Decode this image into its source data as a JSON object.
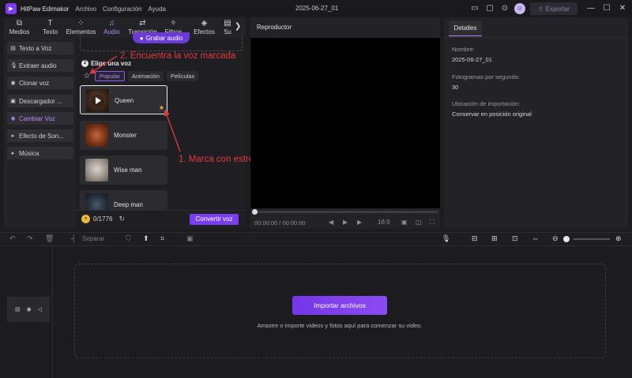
{
  "app": {
    "name": "HitPaw Edimakor",
    "menu": [
      "Archivo",
      "Configuración",
      "Ayuda"
    ],
    "project_name": "2025-06-27_01",
    "export_label": "Exportar",
    "accent_color": "#8a4ff0"
  },
  "tabs": [
    {
      "label": "Medios",
      "icon": "media-icon"
    },
    {
      "label": "Texto",
      "icon": "text-icon"
    },
    {
      "label": "Elementos",
      "icon": "elements-icon"
    },
    {
      "label": "Audio",
      "icon": "music-note-icon",
      "active": true
    },
    {
      "label": "Transición",
      "icon": "transition-icon"
    },
    {
      "label": "Filtros",
      "icon": "filters-icon"
    },
    {
      "label": "Efectos",
      "icon": "effects-icon"
    },
    {
      "label": "Su",
      "icon": "subtitles-icon"
    }
  ],
  "sidebar": {
    "items": [
      {
        "label": "Texto a Voz",
        "icon": "document-icon"
      },
      {
        "label": "Extraer audio",
        "icon": "microphone-icon"
      },
      {
        "label": "Clonar voz",
        "icon": "clone-icon"
      },
      {
        "label": "Descargador ...",
        "icon": "download-icon"
      },
      {
        "label": "Cambiar Voz",
        "icon": "voice-change-icon",
        "active": true
      },
      {
        "label": "Efecto de Son...",
        "icon": "triangle-right-icon"
      },
      {
        "label": "Música",
        "icon": "triangle-right-icon"
      }
    ]
  },
  "voice": {
    "record_label": "Grabar audio",
    "choose_header": "Elige una voz",
    "choose_number": "2",
    "filters": [
      "Popular",
      "Animación",
      "Películas"
    ],
    "cards": [
      {
        "name": "Queen",
        "starred": true,
        "selected": true
      },
      {
        "name": "Monster",
        "starred": false
      },
      {
        "name": "Wise man",
        "starred": false
      },
      {
        "name": "Deep man",
        "starred": false
      }
    ],
    "credits": "0/1776",
    "convert_label": "Convertir voz"
  },
  "annotations": {
    "step1": "1. Marca con estrella la voz",
    "step2": "2. Encuentra la voz marcada"
  },
  "player": {
    "title": "Reproductor",
    "time": "00:00:00 / 00:00:00",
    "ratio": "16:9"
  },
  "details": {
    "tab": "Detalles",
    "fields": [
      {
        "label": "Nombre:",
        "value": "2025-06-27_01"
      },
      {
        "label": "Fotogramas por segundo:",
        "value": "30"
      },
      {
        "label": "Ubicación de importación:",
        "value": "Conservar en posición original"
      }
    ]
  },
  "timeline": {
    "separar_label": "Separar",
    "import_label": "Importar archivos",
    "drop_text": "Arrastre o importe videos y fotos aquí para comenzar su video."
  }
}
